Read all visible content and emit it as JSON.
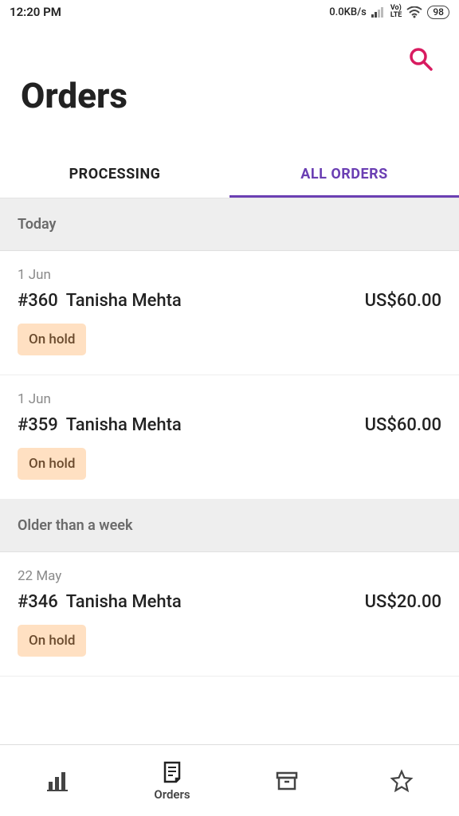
{
  "statusbar": {
    "time": "12:20 PM",
    "speed": "0.0KB/s",
    "lte": "Vo)\nLTE",
    "battery": "98"
  },
  "header": {
    "title": "Orders"
  },
  "tabs": {
    "processing": "PROCESSING",
    "all": "ALL ORDERS"
  },
  "sections": {
    "today": "Today",
    "older": "Older than a week"
  },
  "orders": [
    {
      "date": "1 Jun",
      "id": "#360",
      "name": "Tanisha Mehta",
      "amount": "US$60.00",
      "status": "On hold"
    },
    {
      "date": "1 Jun",
      "id": "#359",
      "name": "Tanisha Mehta",
      "amount": "US$60.00",
      "status": "On hold"
    },
    {
      "date": "22 May",
      "id": "#346",
      "name": "Tanisha Mehta",
      "amount": "US$20.00",
      "status": "On hold"
    }
  ],
  "nav": {
    "orders": "Orders"
  }
}
